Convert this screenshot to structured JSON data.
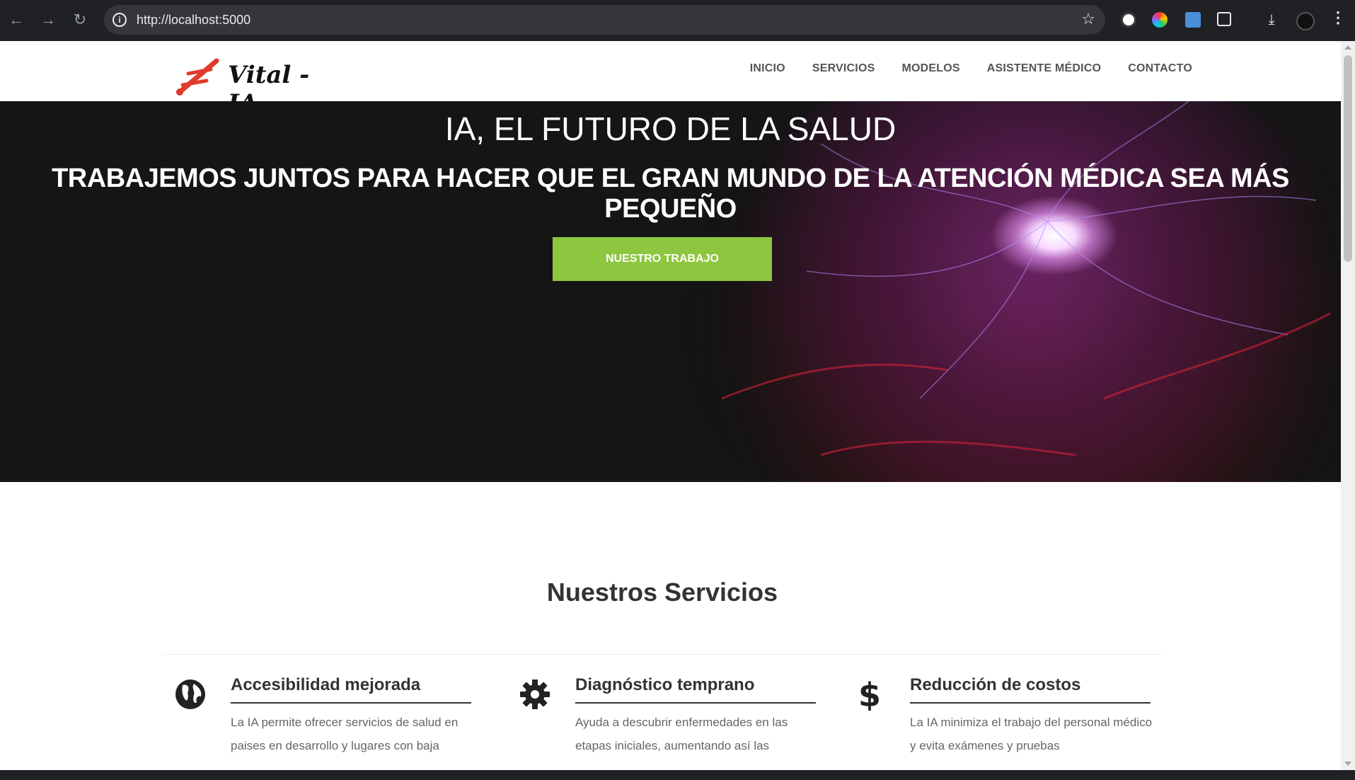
{
  "browser": {
    "url": "http://localhost:5000",
    "back_icon": "arrow-left-icon",
    "forward_icon": "arrow-right-icon",
    "reload_icon": "reload-icon"
  },
  "site": {
    "logo_text": "Vital - IA",
    "nav": [
      {
        "label": "INICIO"
      },
      {
        "label": "SERVICIOS"
      },
      {
        "label": "MODELOS"
      },
      {
        "label": "ASISTENTE MÉDICO"
      },
      {
        "label": "CONTACTO"
      }
    ]
  },
  "hero": {
    "title": "IA, EL FUTURO DE LA SALUD",
    "subtitle": "TRABAJEMOS JUNTOS PARA HACER QUE EL GRAN MUNDO DE LA ATENCIÓN MÉDICA SEA MÁS PEQUEÑO",
    "button_label": "NUESTRO TRABAJO"
  },
  "services": {
    "title": "Nuestros Servicios",
    "items": [
      {
        "icon": "globe-icon",
        "name": "Accesibilidad mejorada",
        "text": "La IA permite ofrecer servicios de salud en paises en desarrollo y lugares con baja"
      },
      {
        "icon": "gear-icon",
        "name": "Diagnóstico temprano",
        "text": "Ayuda a descubrir enfermedades en las etapas iniciales, aumentando así las"
      },
      {
        "icon": "dollar-icon",
        "name": "Reducción de costos",
        "text": "La IA minimiza el trabajo del personal médico y evita exámenes y pruebas"
      }
    ]
  },
  "colors": {
    "accent_green": "#8dc63f",
    "chrome_dark": "#202124"
  }
}
